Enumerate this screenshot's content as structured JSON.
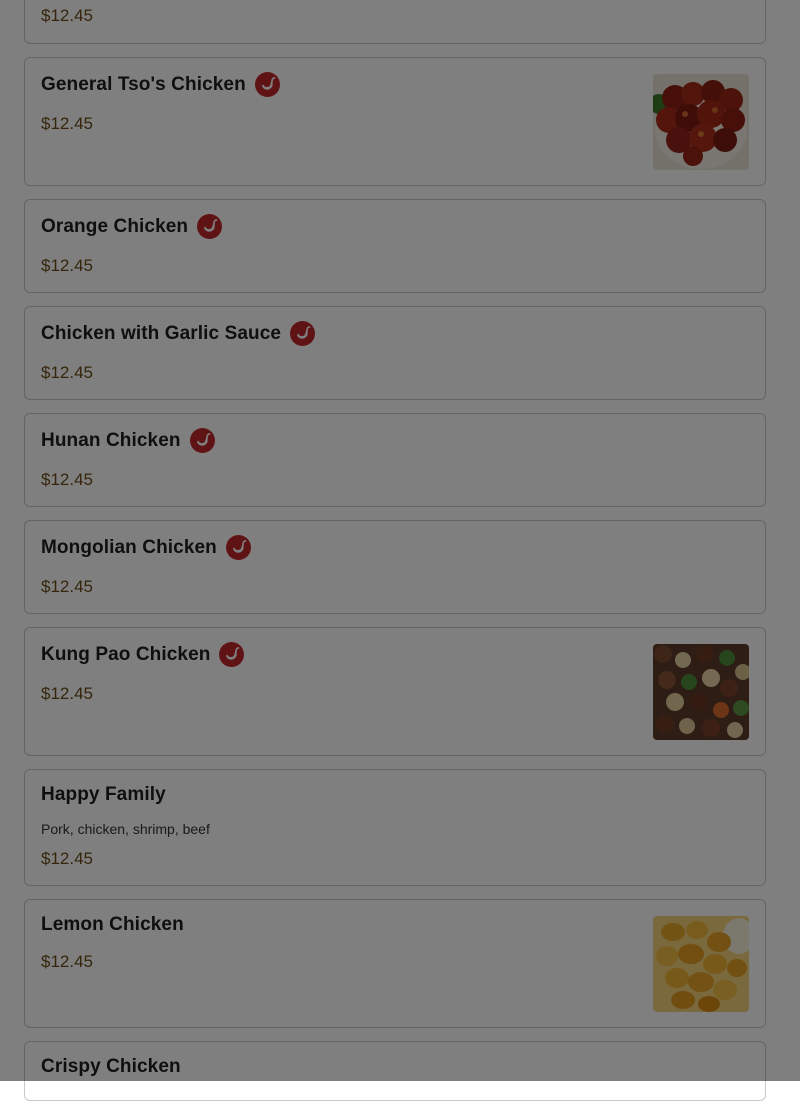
{
  "menu": {
    "spice_icon": "chili-pepper-icon",
    "colors": {
      "spice_badge": "#c0262b",
      "price": "#6b4a17",
      "overlay": "rgba(0,0,0,0.5)"
    },
    "items": [
      {
        "name": "",
        "price": "$12.45"
      },
      {
        "name": "General Tso's Chicken",
        "price": "$12.45",
        "spicy": true,
        "image": "general-tso-chicken-photo"
      },
      {
        "name": "Orange Chicken",
        "price": "$12.45",
        "spicy": true
      },
      {
        "name": "Chicken with Garlic Sauce",
        "price": "$12.45",
        "spicy": true
      },
      {
        "name": "Hunan Chicken",
        "price": "$12.45",
        "spicy": true
      },
      {
        "name": "Mongolian Chicken",
        "price": "$12.45",
        "spicy": true
      },
      {
        "name": "Kung Pao Chicken",
        "price": "$12.45",
        "spicy": true,
        "image": "kung-pao-chicken-photo"
      },
      {
        "name": "Happy Family",
        "description": "Pork, chicken, shrimp, beef",
        "price": "$12.45"
      },
      {
        "name": "Lemon Chicken",
        "price": "$12.45",
        "image": "lemon-chicken-photo"
      },
      {
        "name": "Crispy Chicken"
      }
    ]
  }
}
